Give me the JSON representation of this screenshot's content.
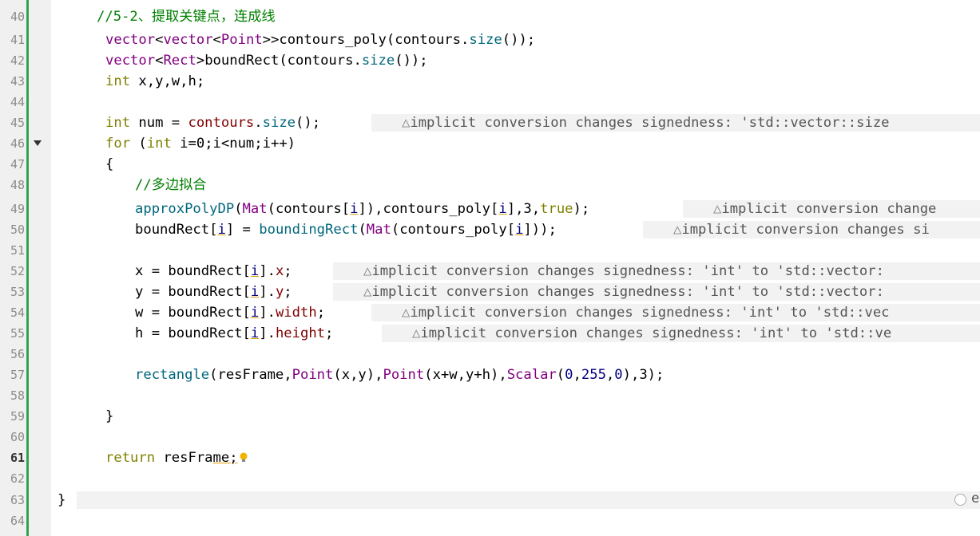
{
  "editor": {
    "warning_icon": "warning-triangle-icon",
    "lines": [
      {
        "no": "40"
      },
      {
        "no": "41"
      },
      {
        "no": "42"
      },
      {
        "no": "43"
      },
      {
        "no": "44"
      },
      {
        "no": "45"
      },
      {
        "no": "46"
      },
      {
        "no": "47"
      },
      {
        "no": "48"
      },
      {
        "no": "49"
      },
      {
        "no": "50"
      },
      {
        "no": "51"
      },
      {
        "no": "52"
      },
      {
        "no": "53"
      },
      {
        "no": "54"
      },
      {
        "no": "55"
      },
      {
        "no": "56"
      },
      {
        "no": "57"
      },
      {
        "no": "58"
      },
      {
        "no": "59"
      },
      {
        "no": "60"
      },
      {
        "no": "61"
      },
      {
        "no": "62"
      },
      {
        "no": "63"
      },
      {
        "no": "64"
      }
    ],
    "current_line": "61",
    "code": {
      "l40": {
        "comment": "//5-2、提取关键点，连成线"
      },
      "l41": {
        "kw": "vector",
        "p1": "<",
        "kw2": "vector",
        "p2": "<",
        "ty": "Point",
        "p3": ">>contours_poly(contours.",
        "fn": "size",
        "p4": "());"
      },
      "l42": {
        "kw": "vector",
        "p1": "<",
        "ty": "Rect",
        "p2": ">boundRect(contours.",
        "fn": "size",
        "p3": "());"
      },
      "l43": {
        "kw": "int",
        "rest": " x,y,w,h;"
      },
      "l45": {
        "kw": "int",
        "p1": " num = ",
        "v": "contours",
        "p2": ".",
        "fn": "size",
        "p3": "();",
        "warn": "implicit conversion changes signedness: 'std::vector::size"
      },
      "l46": {
        "kw": "for",
        "p1": " (",
        "kw2": "int",
        "p2": " i=0;i<num;i++)"
      },
      "l47": {
        "text": "{"
      },
      "l48": {
        "comment": "//多边拟合"
      },
      "l49": {
        "fn": "approxPolyDP",
        "p1": "(",
        "ty": "Mat",
        "p2": "(contours[",
        "i": "i",
        "p3": "]),contours_poly[",
        "i2": "i",
        "p4": "],3,",
        "kw": "true",
        "p5": ");",
        "warn": "implicit conversion change"
      },
      "l50": {
        "p1": "boundRect[",
        "i": "i",
        "p2": "] = ",
        "fn": "boundingRect",
        "p3": "(",
        "ty": "Mat",
        "p4": "(contours_poly[",
        "i2": "i",
        "p5": "]));",
        "warn": "implicit conversion changes si"
      },
      "l52": {
        "p1": "x = boundRect[",
        "i": "i",
        "p2": "].",
        "fld": "x",
        "p3": ";",
        "warn": "implicit conversion changes signedness: 'int' to 'std::vector:"
      },
      "l53": {
        "p1": "y = boundRect[",
        "i": "i",
        "p2": "].",
        "fld": "y",
        "p3": ";",
        "warn": "implicit conversion changes signedness: 'int' to 'std::vector:"
      },
      "l54": {
        "p1": "w = boundRect[",
        "i": "i",
        "p2": "].",
        "fld": "width",
        "p3": ";",
        "warn": "implicit conversion changes signedness: 'int' to 'std::vec"
      },
      "l55": {
        "p1": "h = boundRect[",
        "i": "i",
        "p2": "].",
        "fld": "height",
        "p3": ";",
        "warn": "implicit conversion changes signedness: 'int' to 'std::ve"
      },
      "l57": {
        "fn": "rectangle",
        "p1": "(resFrame,",
        "ty": "Point",
        "p2": "(x,y),",
        "ty2": "Point",
        "p3": "(x+w,y+h),",
        "ty3": "Scalar",
        "p4": "(",
        "n1": "0",
        "c1": ",",
        "n2": "255",
        "c2": ",",
        "n3": "0",
        "p5": "),3);"
      },
      "l59": {
        "text": "}"
      },
      "l61": {
        "kw": "return",
        "p1": " resFra",
        "sq": "me;"
      },
      "l63": {
        "text": "}",
        "info_text": "e"
      }
    }
  }
}
